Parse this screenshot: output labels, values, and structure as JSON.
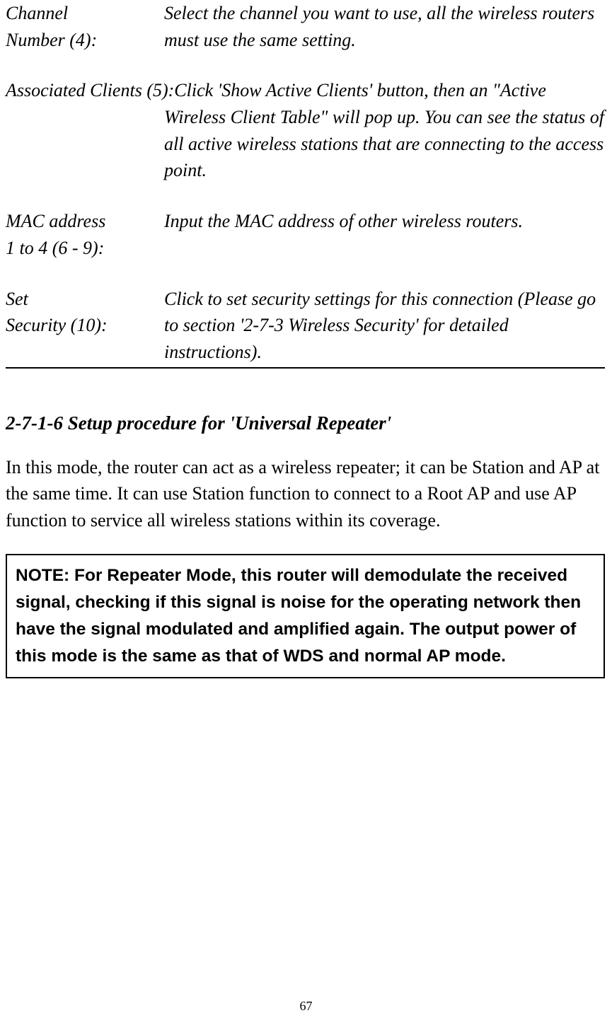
{
  "defs": {
    "channel": {
      "label_line1": "Channel",
      "label_line2": "Number (4):",
      "desc": "Select the channel you want to use, all the wireless routers must use the same setting."
    },
    "assoc_clients": {
      "label": "Associated Clients (5):",
      "desc_first": "Click 'Show Active Clients' button, then an \"Active",
      "desc_rest": "Wireless Client Table\" will pop up. You can see the status of all active wireless stations that are connecting to the access point."
    },
    "mac": {
      "label_line1": "MAC address",
      "label_line2": "1 to 4 (6 - 9):",
      "desc": "Input the MAC address of other wireless routers."
    },
    "set_security": {
      "label_line1": "Set",
      "label_line2": "Security (10):",
      "desc": "Click to set security settings for this connection (Please go to section '2-7-3 Wireless Security' for detailed instructions)."
    }
  },
  "section_title": "2-7-1-6 Setup procedure for 'Universal Repeater'",
  "body": "In this mode, the router can act as a wireless repeater; it can be Station and AP at the same time. It can use Station function to connect to a Root AP and use AP function to service all wireless stations within its coverage.",
  "note": "NOTE: For Repeater Mode, this router will demodulate the received signal, checking if this signal is noise for the operating network then have the signal modulated and amplified again. The output power of this mode is the same as that of WDS and normal AP mode.",
  "page_number": "67"
}
